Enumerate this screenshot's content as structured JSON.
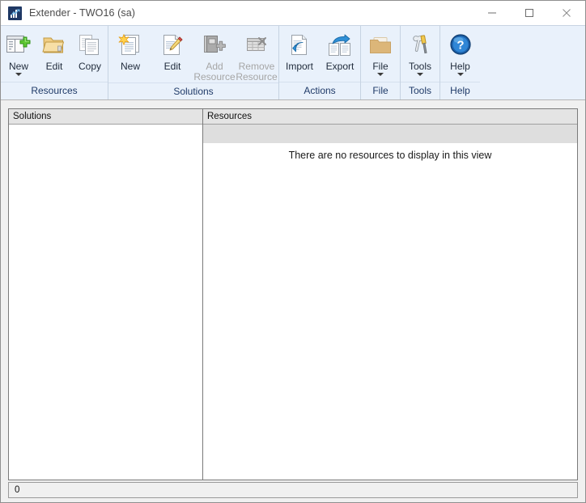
{
  "window": {
    "title": "Extender  -  TWO16 (sa)",
    "app_icon": "chart-icon",
    "controls": {
      "minimize": "minimize-icon",
      "maximize": "maximize-icon",
      "close": "close-icon"
    }
  },
  "ribbon": {
    "groups": [
      {
        "label": "Resources",
        "items": [
          {
            "label": "New",
            "icon": "new-window-plus-icon",
            "enabled": true,
            "dropdown": true
          },
          {
            "label": "Edit",
            "icon": "open-folder-icon",
            "enabled": true,
            "dropdown": false
          },
          {
            "label": "Copy",
            "icon": "copy-pages-icon",
            "enabled": true,
            "dropdown": false
          }
        ]
      },
      {
        "label": "Solutions",
        "items": [
          {
            "label": "New",
            "icon": "new-document-star-icon",
            "enabled": true,
            "dropdown": false
          },
          {
            "label": "Edit",
            "icon": "edit-document-pencil-icon",
            "enabled": true,
            "dropdown": false
          },
          {
            "label": "Add\nResource",
            "icon": "add-resource-icon",
            "enabled": false,
            "dropdown": false
          },
          {
            "label": "Remove\nResource",
            "icon": "remove-resource-icon",
            "enabled": false,
            "dropdown": false
          }
        ]
      },
      {
        "label": "Actions",
        "items": [
          {
            "label": "Import",
            "icon": "import-icon",
            "enabled": true,
            "dropdown": false
          },
          {
            "label": "Export",
            "icon": "export-icon",
            "enabled": true,
            "dropdown": false
          }
        ]
      },
      {
        "label": "File",
        "items": [
          {
            "label": "File",
            "icon": "folder-icon",
            "enabled": true,
            "dropdown": true
          }
        ]
      },
      {
        "label": "Tools",
        "items": [
          {
            "label": "Tools",
            "icon": "tools-icon",
            "enabled": true,
            "dropdown": true
          }
        ]
      },
      {
        "label": "Help",
        "items": [
          {
            "label": "Help",
            "icon": "help-icon",
            "enabled": true,
            "dropdown": true
          }
        ]
      }
    ]
  },
  "panes": {
    "solutions": {
      "header": "Solutions",
      "items": []
    },
    "resources": {
      "header": "Resources",
      "empty_message": "There are no resources to display in this view",
      "items": []
    }
  },
  "statusbar": {
    "text": "0"
  },
  "colors": {
    "ribbon_background": "#e9f1fb",
    "group_label_text": "#1f3a68",
    "title_text": "#4a4a4a",
    "pane_header": "#e4e4e4",
    "accent_blue": "#1d7fd0",
    "folder_tan": "#dcb679",
    "plus_green": "#4eb82b",
    "disabled_grey": "#a6a6a6"
  }
}
